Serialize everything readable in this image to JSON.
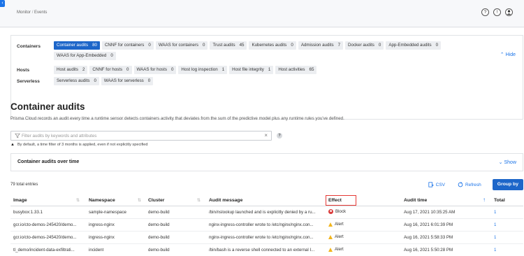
{
  "breadcrumb": {
    "root": "Monitor",
    "separator": "/",
    "current": "Events"
  },
  "top_icons": [
    "question-icon",
    "alert-icon",
    "user-icon"
  ],
  "filters": {
    "containers_label": "Containers",
    "containers": [
      {
        "label": "Container audits",
        "count": "80",
        "active": true
      },
      {
        "label": "CNNF for containers",
        "count": "0"
      },
      {
        "label": "WAAS for containers",
        "count": "0"
      },
      {
        "label": "Trust audits",
        "count": "45"
      },
      {
        "label": "Kubernetes audits",
        "count": "0"
      },
      {
        "label": "Admission audits",
        "count": "7"
      },
      {
        "label": "Docker audits",
        "count": "0"
      },
      {
        "label": "App-Embedded audits",
        "count": "0"
      },
      {
        "label": "WAAS for App-Embedded",
        "count": "0"
      }
    ],
    "hosts_label": "Hosts",
    "hosts": [
      {
        "label": "Host audits",
        "count": "2"
      },
      {
        "label": "CNNF for hosts",
        "count": "0"
      },
      {
        "label": "WAAS for hosts",
        "count": "0"
      },
      {
        "label": "Host log inspection",
        "count": "1"
      },
      {
        "label": "Host file integrity",
        "count": "1"
      },
      {
        "label": "Host activities",
        "count": "65"
      }
    ],
    "serverless_label": "Serverless",
    "serverless": [
      {
        "label": "Serverless audits",
        "count": "0"
      },
      {
        "label": "WAAS for serverless",
        "count": "0"
      }
    ],
    "hide_label": "Hide"
  },
  "page": {
    "title": "Container audits",
    "description": "Prisma Cloud records an audit every time a runtime sensor detects containers activity that deviates from the sum of the predictive model plus any runtime rules you've defined."
  },
  "search": {
    "placeholder": "Filter audits by keywords and attributes",
    "value": "",
    "help": "?",
    "info": "By default, a time filter of 3 months is applied, even if not explicitly specified"
  },
  "chart_panel": {
    "title": "Container audits over time",
    "show_label": "Show"
  },
  "table_toolbar": {
    "total": "79 total entries",
    "csv_label": "CSV",
    "refresh_label": "Refresh",
    "groupby_label": "Group by"
  },
  "table": {
    "headers": [
      "Image",
      "Namespace",
      "Cluster",
      "Audit message",
      "Effect",
      "Audit time",
      "Total"
    ],
    "rows": [
      {
        "image": "busybox:1.33.1",
        "namespace": "sample-namespace",
        "cluster": "demo-build",
        "message": "/bin/nslookup launched and is explicitly denied by a ru...",
        "effect": "Block",
        "time": "Aug 17, 2021 10:35:25 AM",
        "total": "1"
      },
      {
        "image": "gcr.io/cto-demos-245420/demo...",
        "namespace": "ingress-nginx",
        "cluster": "demo-build",
        "message": "nginx-ingress-controller wrote to /etc/nginx/nginx.con...",
        "effect": "Alert",
        "time": "Aug 16, 2021 6:01:39 PM",
        "total": "1"
      },
      {
        "image": "gcr.io/cto-demos-245420/demo...",
        "namespace": "ingress-nginx",
        "cluster": "demo-build",
        "message": "nginx-ingress-controller wrote to /etc/nginx/nginx.con...",
        "effect": "Alert",
        "time": "Aug 16, 2021 5:58:33 PM",
        "total": "1"
      },
      {
        "image": "tl_demo/incident-data-exfiltrati...",
        "namespace": "incident",
        "cluster": "demo-build",
        "message": "/bin/bash is a reverse shell connected to an external I...",
        "effect": "Alert",
        "time": "Aug 16, 2021 5:50:28 PM",
        "total": "1"
      }
    ]
  },
  "colors": {
    "accent": "#1d66c9",
    "link": "#1a73e8",
    "block": "#d93b3b",
    "alert": "#f2b51c",
    "highlight": "#e53935"
  }
}
